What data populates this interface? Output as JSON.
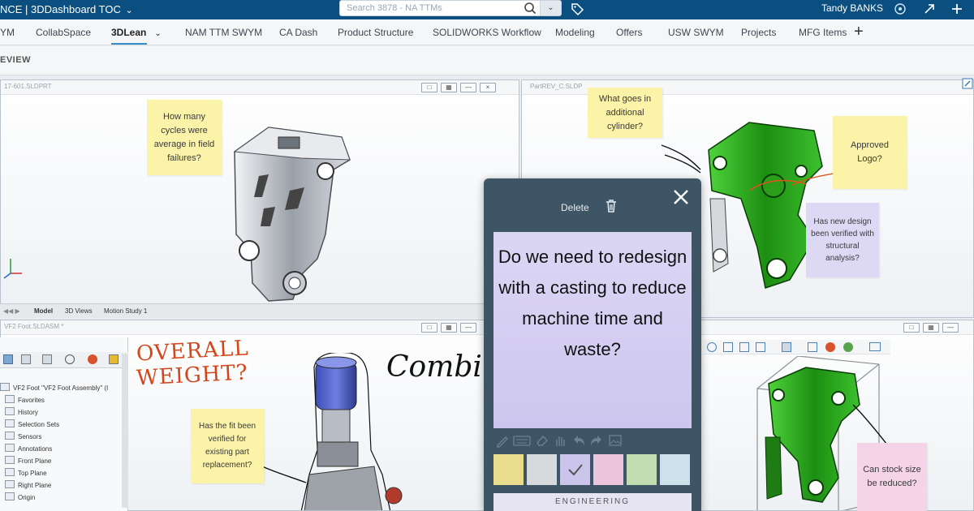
{
  "topbar": {
    "brand": "NCE | 3DDashboard  TOC",
    "search_placeholder": "Search 3878 - NA TTMs",
    "user": "Tandy BANKS"
  },
  "tabs": [
    {
      "label": "YM"
    },
    {
      "label": "CollabSpace"
    },
    {
      "label": "3DLean"
    },
    {
      "label": "NAM TTM SWYM"
    },
    {
      "label": "CA Dash"
    },
    {
      "label": "Product Structure"
    },
    {
      "label": "SOLIDWORKS Workflow"
    },
    {
      "label": "Modeling"
    },
    {
      "label": "Offers"
    },
    {
      "label": "USW SWYM"
    },
    {
      "label": "Projects"
    },
    {
      "label": "MFG Items"
    }
  ],
  "subbar": {
    "label": "EVIEW"
  },
  "viewports": {
    "top_left_title": "17-601.SLDPRT",
    "top_right_title": "PartREV_C.SLDP",
    "bottom_left_title": "VF2 Foot.SLDASM *"
  },
  "model_tabs": [
    "Model",
    "3D Views",
    "Motion Study 1"
  ],
  "stickies": {
    "cycles": "How many cycles were average in field failures?",
    "cylinder": "What goes in additional cylinder?",
    "logo": "Approved Logo?",
    "structural": "Has new design been verified with structural analysis?",
    "fit": "Has the fit been verified for existing part replacement?",
    "stock": "Can stock size be reduced?"
  },
  "handwriting": {
    "overall": "OVERALL",
    "weight": "WEIGHT?",
    "combine": "Combine"
  },
  "tree": {
    "root": "VF2 Foot \"VF2 Foot Assembly\" (I",
    "items": [
      "Favorites",
      "History",
      "Selection Sets",
      "Sensors",
      "Annotations",
      "Front Plane",
      "Top Plane",
      "Right Plane",
      "Origin"
    ]
  },
  "editor": {
    "delete_label": "Delete",
    "note_text": "Do we need to redesign with a casting to reduce machine time and waste?",
    "footer": "ENGINEERING",
    "swatches": [
      "#e9dc8c",
      "#d7dadd",
      "#cbc5ec",
      "#ecc4de",
      "#c1dcb1",
      "#cde1ea"
    ],
    "selected_swatch": 2
  }
}
